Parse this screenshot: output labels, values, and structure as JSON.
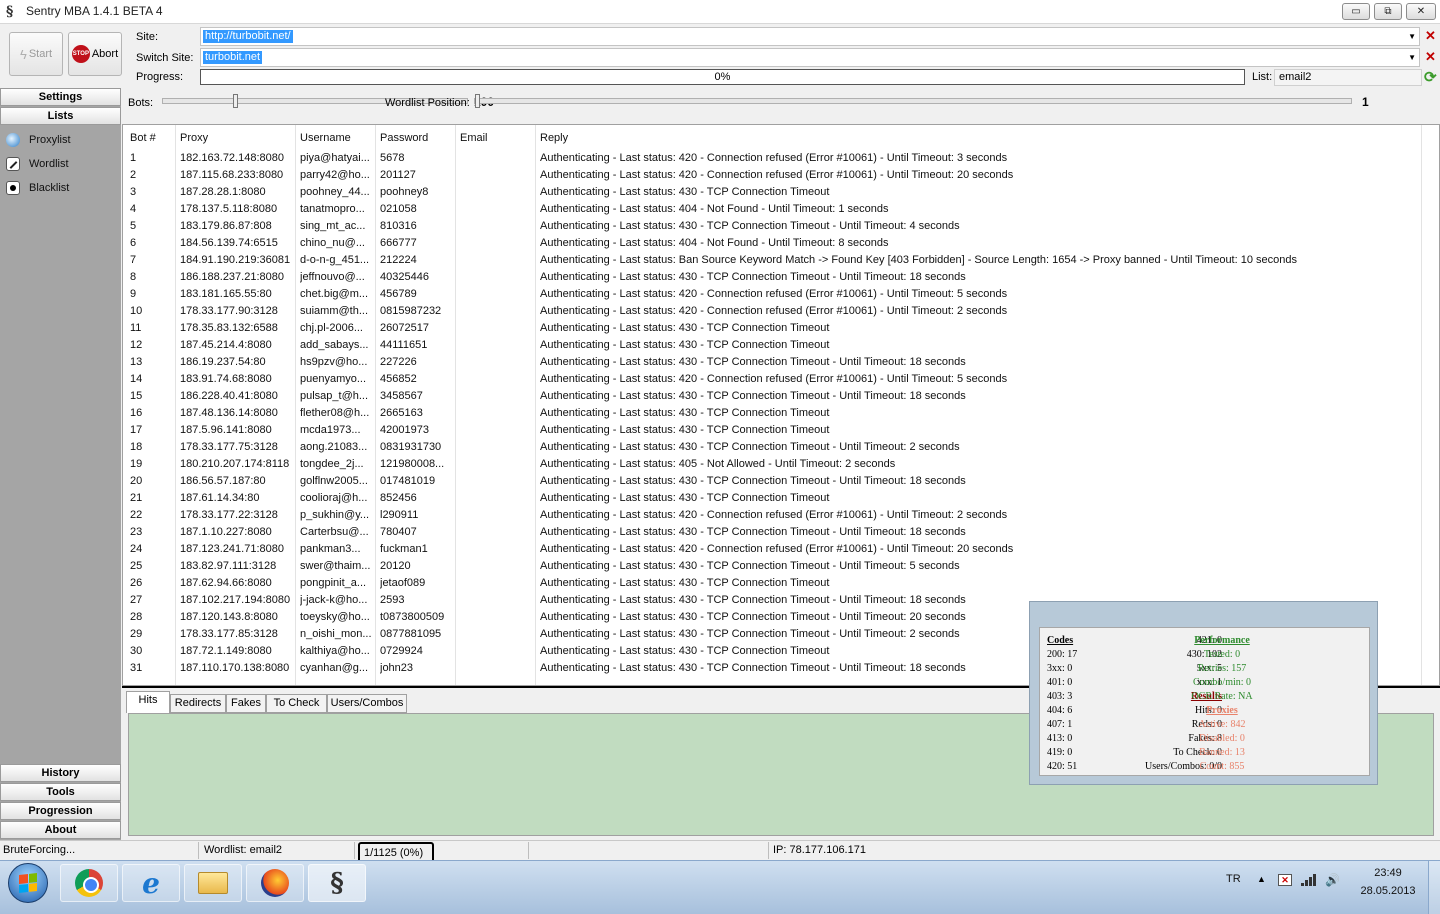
{
  "window": {
    "title": "Sentry MBA 1.4.1 BETA 4",
    "min_label": "▭",
    "max_label": "⧉",
    "close_label": "✕"
  },
  "toolbar": {
    "start_label": "Start",
    "abort_label": "Abort",
    "stop_icon_text": "STOP",
    "site_label": "Site:",
    "site_value": "http://turbobit.net/",
    "switch_label": "Switch Site:",
    "switch_value": "turbobit.net",
    "progress_label": "Progress:",
    "progress_text": "0%",
    "progress_fraction": 0,
    "list_label": "List:",
    "list_value": "email2"
  },
  "sidebar": {
    "settings": "Settings",
    "lists": "Lists",
    "items": [
      "Proxylist",
      "Wordlist",
      "Blacklist"
    ],
    "history": "History",
    "tools": "Tools",
    "progression": "Progression",
    "about": "About"
  },
  "sliders": {
    "bots_label": "Bots:",
    "bots_value": "100",
    "wordlist_label": "Wordlist Position:",
    "wordlist_value": "1"
  },
  "table": {
    "headers": [
      "Bot #",
      "Proxy",
      "Username",
      "Password",
      "Email",
      "Reply"
    ],
    "rows": [
      [
        "1",
        "182.163.72.148:8080",
        "piya@hatyai...",
        "5678",
        "",
        "Authenticating - Last status: 420 - Connection refused (Error #10061) - Until Timeout: 3 seconds"
      ],
      [
        "2",
        "187.115.68.233:8080",
        "parry42@ho...",
        "201127",
        "",
        "Authenticating - Last status: 420 - Connection refused (Error #10061) - Until Timeout: 20 seconds"
      ],
      [
        "3",
        "187.28.28.1:8080",
        "poohney_44...",
        "poohney8",
        "",
        "Authenticating - Last status: 430 - TCP Connection Timeout"
      ],
      [
        "4",
        "178.137.5.118:8080",
        "tanatmopro...",
        "021058",
        "",
        "Authenticating - Last status: 404 - Not Found - Until Timeout: 1 seconds"
      ],
      [
        "5",
        "183.179.86.87:808",
        "sing_mt_ac...",
        "810316",
        "",
        "Authenticating - Last status: 430 - TCP Connection Timeout - Until Timeout: 4 seconds"
      ],
      [
        "6",
        "184.56.139.74:6515",
        "chino_nu@...",
        "666777",
        "",
        "Authenticating - Last status: 404 - Not Found - Until Timeout: 8 seconds"
      ],
      [
        "7",
        "184.91.190.219:36081",
        "d-o-n-g_451...",
        "212224",
        "",
        "Authenticating - Last status: Ban Source Keyword Match -> Found Key [403 Forbidden] - Source Length: 1654 -> Proxy banned - Until Timeout: 10 seconds"
      ],
      [
        "8",
        "186.188.237.21:8080",
        "jeffnouvo@...",
        "40325446",
        "",
        "Authenticating - Last status: 430 - TCP Connection Timeout - Until Timeout: 18 seconds"
      ],
      [
        "9",
        "183.181.165.55:80",
        "chet.big@m...",
        "456789",
        "",
        "Authenticating - Last status: 420 - Connection refused (Error #10061) - Until Timeout: 5 seconds"
      ],
      [
        "10",
        "178.33.177.90:3128",
        "suiamm@th...",
        "0815987232",
        "",
        "Authenticating - Last status: 420 - Connection refused (Error #10061) - Until Timeout: 2 seconds"
      ],
      [
        "11",
        "178.35.83.132:6588",
        "chj.pl-2006...",
        "26072517",
        "",
        "Authenticating - Last status: 430 - TCP Connection Timeout"
      ],
      [
        "12",
        "187.45.214.4:8080",
        "add_sabays...",
        "44111651",
        "",
        "Authenticating - Last status: 430 - TCP Connection Timeout"
      ],
      [
        "13",
        "186.19.237.54:80",
        "hs9pzv@ho...",
        "227226",
        "",
        "Authenticating - Last status: 430 - TCP Connection Timeout - Until Timeout: 18 seconds"
      ],
      [
        "14",
        "183.91.74.68:8080",
        "puenyamyo...",
        "456852",
        "",
        "Authenticating - Last status: 420 - Connection refused (Error #10061) - Until Timeout: 5 seconds"
      ],
      [
        "15",
        "186.228.40.41:8080",
        "pulsap_t@h...",
        "3458567",
        "",
        "Authenticating - Last status: 430 - TCP Connection Timeout - Until Timeout: 18 seconds"
      ],
      [
        "16",
        "187.48.136.14:8080",
        "flether08@h...",
        "2665163",
        "",
        "Authenticating - Last status: 430 - TCP Connection Timeout"
      ],
      [
        "17",
        "187.5.96.141:8080",
        "mcda1973...",
        "42001973",
        "",
        "Authenticating - Last status: 430 - TCP Connection Timeout"
      ],
      [
        "18",
        "178.33.177.75:3128",
        "aong.21083...",
        "0831931730",
        "",
        "Authenticating - Last status: 430 - TCP Connection Timeout - Until Timeout: 2 seconds"
      ],
      [
        "19",
        "180.210.207.174:8118",
        "tongdee_2j...",
        "121980008...",
        "",
        "Authenticating - Last status: 405 - Not Allowed - Until Timeout: 2 seconds"
      ],
      [
        "20",
        "186.56.57.187:80",
        "golflnw2005...",
        "017481019",
        "",
        "Authenticating - Last status: 430 - TCP Connection Timeout - Until Timeout: 18 seconds"
      ],
      [
        "21",
        "187.61.14.34:80",
        "coolioraj@h...",
        "852456",
        "",
        "Authenticating - Last status: 430 - TCP Connection Timeout"
      ],
      [
        "22",
        "178.33.177.22:3128",
        "p_sukhin@y...",
        "l290911",
        "",
        "Authenticating - Last status: 420 - Connection refused (Error #10061) - Until Timeout: 2 seconds"
      ],
      [
        "23",
        "187.1.10.227:8080",
        "Carterbsu@...",
        "780407",
        "",
        "Authenticating - Last status: 430 - TCP Connection Timeout - Until Timeout: 18 seconds"
      ],
      [
        "24",
        "187.123.241.71:8080",
        "pankman3...",
        "fuckman1",
        "",
        "Authenticating - Last status: 420 - Connection refused (Error #10061) - Until Timeout: 20 seconds"
      ],
      [
        "25",
        "183.82.97.111:3128",
        "swer@thaim...",
        "20120",
        "",
        "Authenticating - Last status: 430 - TCP Connection Timeout - Until Timeout: 5 seconds"
      ],
      [
        "26",
        "187.62.94.66:8080",
        "pongpinit_a...",
        "jetaof089",
        "",
        "Authenticating - Last status: 430 - TCP Connection Timeout"
      ],
      [
        "27",
        "187.102.217.194:8080",
        "j-jack-k@ho...",
        "2593",
        "",
        "Authenticating - Last status: 430 - TCP Connection Timeout - Until Timeout: 18 seconds"
      ],
      [
        "28",
        "187.120.143.8:8080",
        "toeysky@ho...",
        "t0873800509",
        "",
        "Authenticating - Last status: 430 - TCP Connection Timeout - Until Timeout: 20 seconds"
      ],
      [
        "29",
        "178.33.177.85:3128",
        "n_oishi_mon...",
        "0877881095",
        "",
        "Authenticating - Last status: 430 - TCP Connection Timeout - Until Timeout: 2 seconds"
      ],
      [
        "30",
        "187.72.1.149:8080",
        "kalthiya@ho...",
        "0729924",
        "",
        "Authenticating - Last status: 430 - TCP Connection Timeout"
      ],
      [
        "31",
        "187.110.170.138:8080",
        "cyanhan@g...",
        "john23",
        "",
        "Authenticating - Last status: 430 - TCP Connection Timeout - Until Timeout: 18 seconds"
      ]
    ]
  },
  "tabs": [
    "Hits",
    "Redirects",
    "Fakes",
    "To Check",
    "Users/Combos"
  ],
  "stats": {
    "col1": [
      "Codes",
      "200: 17",
      "3xx: 0",
      "401: 0",
      "403: 3",
      "404: 6",
      "407: 1",
      "413: 0",
      "419: 0",
      "420: 51"
    ],
    "col2": [
      "421: 0",
      "430: 102",
      "5xx: 5",
      "xxx: 1",
      "Results",
      "Hits: 0",
      "Reds: 0",
      "Fakes: 8",
      "To Check: 0",
      "Users/Combos: 0/0"
    ],
    "col3": [
      "Performance",
      "Tested: 0",
      "Retries: 157",
      "Combo/min: 0",
      "OCR Rate: NA",
      "Proxies",
      "Active: 842",
      "Disabled: 0",
      "Banned: 13",
      "Count: 855"
    ]
  },
  "status": {
    "state": "BruteForcing...",
    "wordlist": "Wordlist: email2",
    "counter": "1/1125 (0%)",
    "ip": "IP: 78.177.106.171"
  },
  "taskbar": {
    "lang": "TR",
    "tray_up": "▲",
    "flag_mark": "✕",
    "volume": "🔊",
    "time": "23:49",
    "date": "28.05.2013",
    "sentry_glyph": "§",
    "ie_glyph": "e"
  }
}
